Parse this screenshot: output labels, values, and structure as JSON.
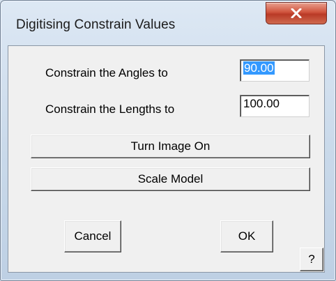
{
  "window": {
    "title": "Digitising Constrain Values",
    "close_icon": "close-x-icon"
  },
  "form": {
    "angles_label": "Constrain the Angles to",
    "angles_value": "90.00",
    "lengths_label": "Constrain the Lengths to",
    "lengths_value": "100.00"
  },
  "buttons": {
    "turn_image_on": "Turn Image On",
    "scale_model": "Scale Model",
    "cancel": "Cancel",
    "ok": "OK",
    "help": "?"
  },
  "colors": {
    "close_button": "#c9452f",
    "selection": "#3399ff"
  }
}
